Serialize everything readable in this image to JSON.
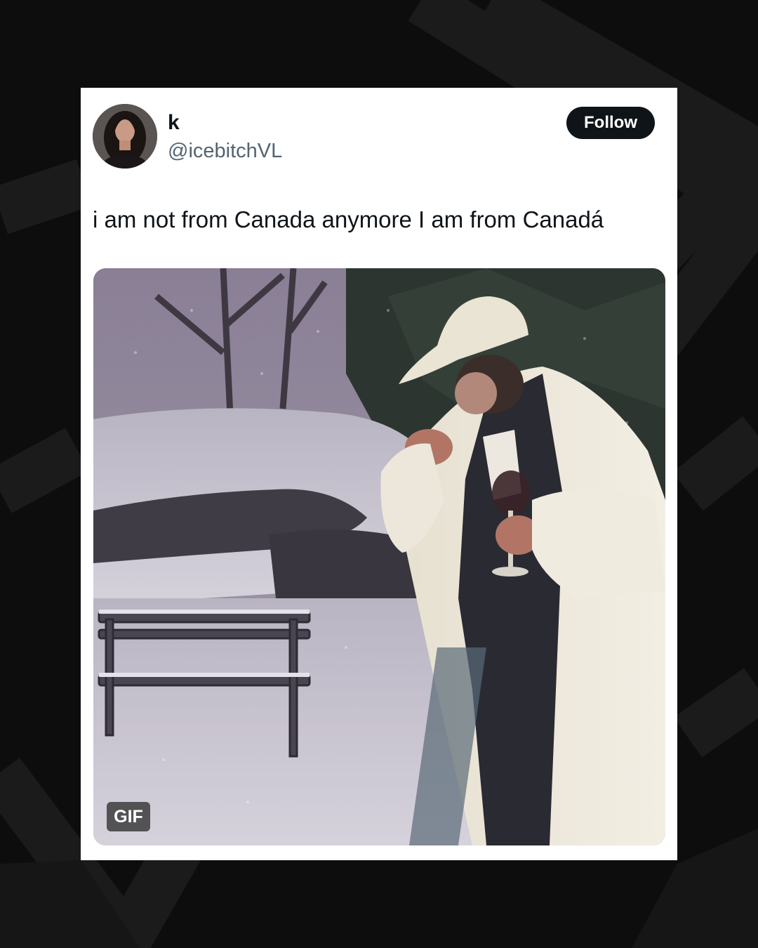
{
  "tweet": {
    "display_name": "k",
    "handle": "@icebitchVL",
    "follow_label": "Follow",
    "text": "i am not from Canada anymore I am from Canadá",
    "media": {
      "badge": "GIF"
    }
  },
  "colors": {
    "page_background": "#0d0d0d",
    "card_background": "#ffffff",
    "follow_button": "#0f1419",
    "handle_text": "#536471"
  },
  "icons": {
    "avatar": "profile-photo",
    "media": "gif-snow-scene"
  }
}
